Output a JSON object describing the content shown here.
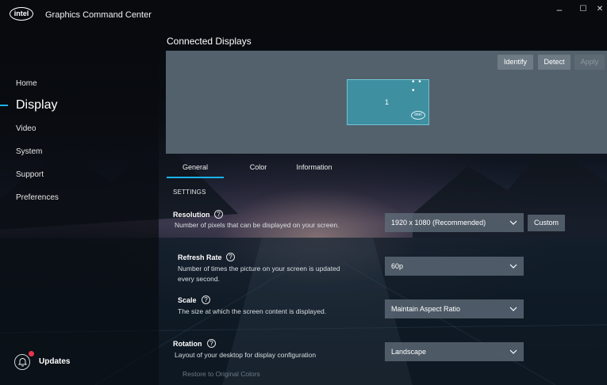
{
  "app": {
    "logo_text": "intel",
    "title": "Graphics Command Center"
  },
  "window": {
    "minimize_glyph": "–",
    "maximize_glyph": "☐",
    "close_glyph": "✕"
  },
  "sidebar": {
    "items": [
      {
        "label": "Home"
      },
      {
        "label": "Display",
        "active": true
      },
      {
        "label": "Video"
      },
      {
        "label": "System"
      },
      {
        "label": "Support"
      },
      {
        "label": "Preferences"
      }
    ],
    "updates_label": "Updates",
    "updates_icon": "bell-icon",
    "accent_color": "#19b4f0",
    "badge_color": "#e8344a"
  },
  "connected_displays": {
    "title": "Connected Displays",
    "buttons": {
      "identify": "Identify",
      "detect": "Detect",
      "apply": "Apply"
    },
    "monitor": {
      "number": "1",
      "menu_glyph": "• • •",
      "logo_text": "intel"
    }
  },
  "tabs": [
    {
      "label": "General",
      "active": true
    },
    {
      "label": "Color"
    },
    {
      "label": "Information"
    }
  ],
  "settings": {
    "section_label": "SETTINGS",
    "help_glyph": "?",
    "resolution": {
      "title": "Resolution",
      "description": "Number of pixels that can be displayed on your screen.",
      "value": "1920 x 1080 (Recommended)",
      "custom_label": "Custom"
    },
    "refresh_rate": {
      "title": "Refresh Rate",
      "description_line1": "Number of times the picture on your screen is updated",
      "description_line2": "every second.",
      "value": "60p"
    },
    "scale": {
      "title": "Scale",
      "description": "The size at which the screen content is displayed.",
      "value": "Maintain Aspect Ratio"
    },
    "rotation": {
      "title": "Rotation",
      "description": "Layout of your desktop for display configuration",
      "value": "Landscape"
    },
    "restore_label": "Restore to Original Colors"
  }
}
